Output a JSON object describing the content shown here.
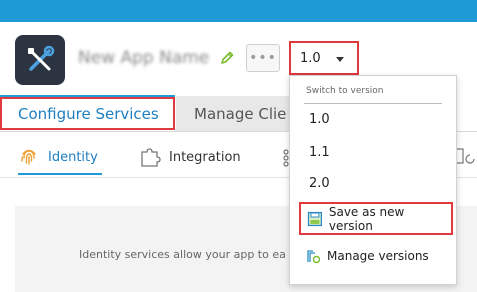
{
  "app": {
    "name": "New App Name",
    "icon": "tools-icon",
    "more_label": "•••"
  },
  "version_select": {
    "value": "1.0"
  },
  "tabs": [
    {
      "label": "Configure Services",
      "active": true
    },
    {
      "label": "Manage Clie",
      "active": false
    }
  ],
  "subtabs": [
    {
      "label": "Identity",
      "icon": "fingerprint-icon",
      "active": true
    },
    {
      "label": "Integration",
      "icon": "puzzle-icon",
      "active": false
    }
  ],
  "content": {
    "text": "Identity services allow your app to ea                                                          fro"
  },
  "version_dropdown": {
    "header": "Switch to version",
    "versions": [
      "1.0",
      "1.1",
      "2.0"
    ],
    "save_label": "Save as new version",
    "manage_label": "Manage versions"
  },
  "colors": {
    "accent": "#1e9ad6",
    "highlight": "#e0393e"
  }
}
